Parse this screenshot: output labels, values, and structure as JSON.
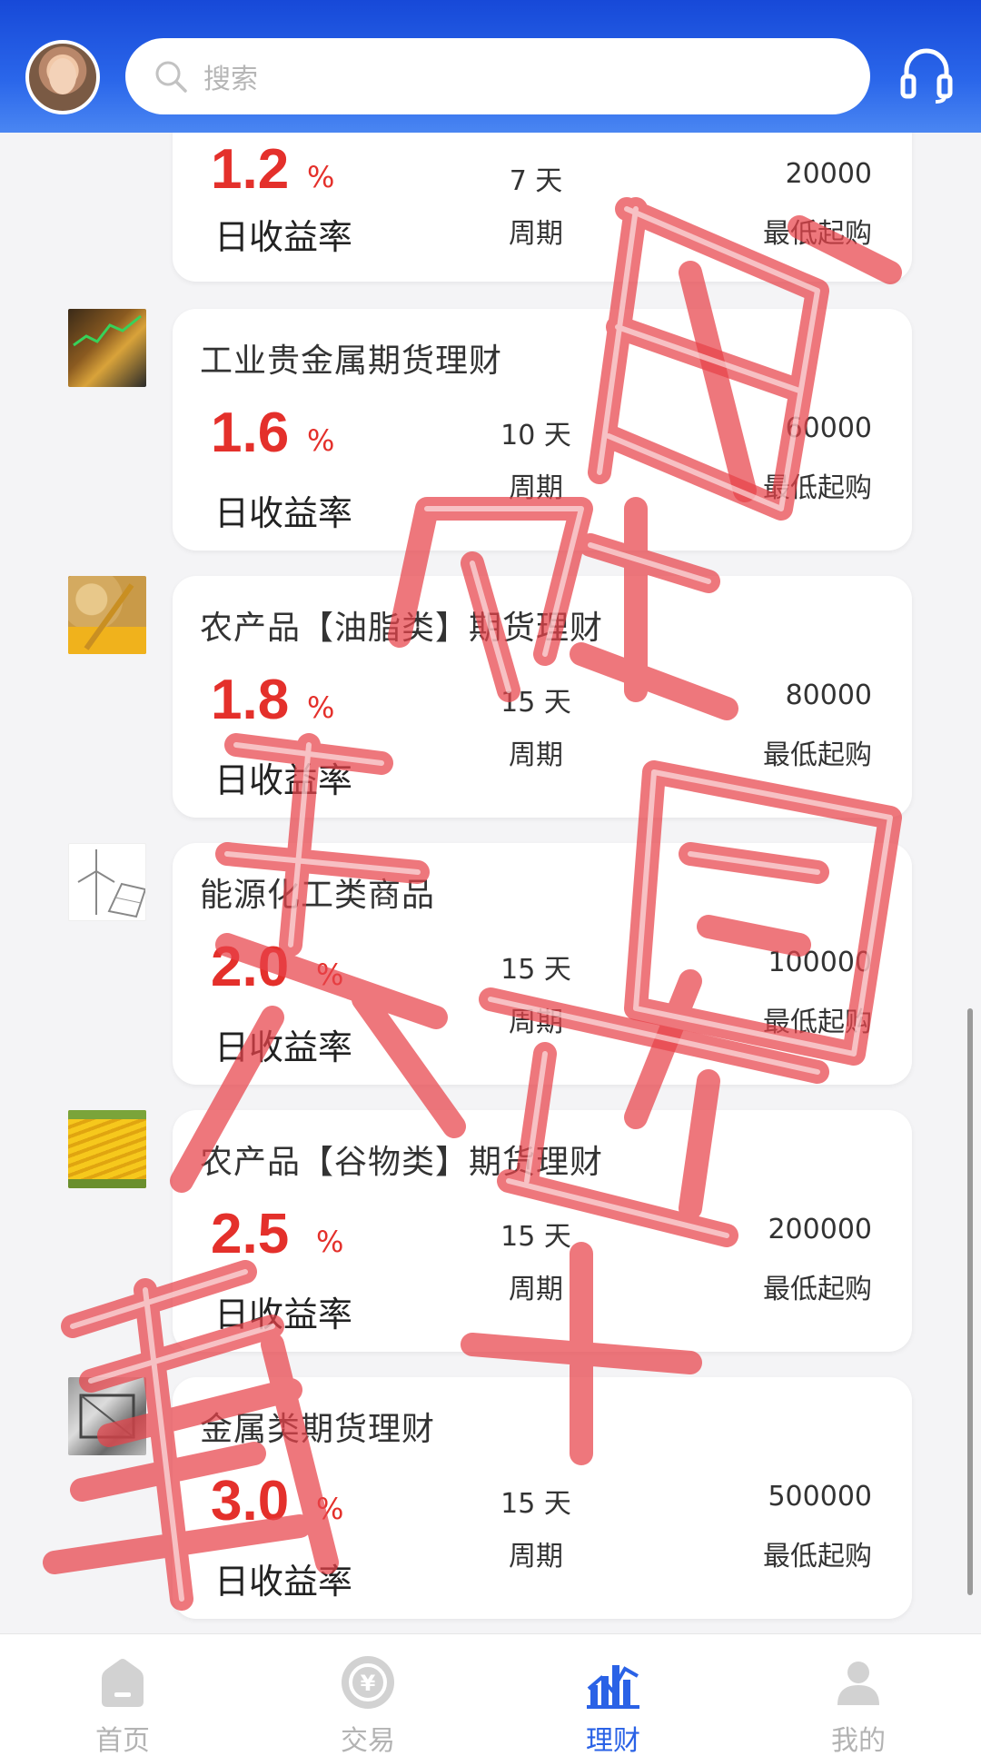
{
  "header": {
    "search_placeholder": "搜索",
    "avatar_icon": "avatar-icon",
    "support_icon": "headset-icon",
    "colors": {
      "header_top": "#1749d8",
      "header_bottom": "#4a86f2"
    }
  },
  "products": [
    {
      "title": "",
      "rate": "1.2",
      "unit": "%",
      "rate_label": "日收益率",
      "days": "7 天",
      "days_label": "周期",
      "min": "20000",
      "min_label": "最低起购",
      "thumb": "none"
    },
    {
      "title": "工业贵金属期货理财",
      "rate": "1.6",
      "unit": "%",
      "rate_label": "日收益率",
      "days": "10 天",
      "days_label": "周期",
      "min": "60000",
      "min_label": "最低起购",
      "thumb": "gold-coins-chart"
    },
    {
      "title": "农产品【油脂类】期货理财",
      "rate": "1.8",
      "unit": "%",
      "rate_label": "日收益率",
      "days": "15 天",
      "days_label": "周期",
      "min": "80000",
      "min_label": "最低起购",
      "thumb": "soybeans-corn"
    },
    {
      "title": "能源化工类商品",
      "rate": "2.0",
      "unit": "%",
      "rate_label": "日收益率",
      "days": "15 天",
      "days_label": "周期",
      "min": "100000",
      "min_label": "最低起购",
      "thumb": "wind-solar"
    },
    {
      "title": "农产品【谷物类】期货理财",
      "rate": "2.5",
      "unit": "%",
      "rate_label": "日收益率",
      "days": "15 天",
      "days_label": "周期",
      "min": "200000",
      "min_label": "最低起购",
      "thumb": "corn"
    },
    {
      "title": "金属类期货理财",
      "rate": "3.0",
      "unit": "%",
      "rate_label": "日收益率",
      "days": "15 天",
      "days_label": "周期",
      "min": "500000",
      "min_label": "最低起购",
      "thumb": "metal-bars"
    }
  ],
  "nav": [
    {
      "label": "首页",
      "icon": "home-icon",
      "active": false
    },
    {
      "label": "交易",
      "icon": "yuan-exchange-icon",
      "active": false
    },
    {
      "label": "理财",
      "icon": "chart-icon",
      "active": true
    },
    {
      "label": "我的",
      "icon": "user-icon",
      "active": false
    }
  ],
  "watermark": {
    "text": "账户 冻结 骗 骗",
    "color": "#e8424a"
  },
  "colors": {
    "accent": "#2a62e6",
    "rate": "#e4302b",
    "background": "#f4f4f6"
  }
}
